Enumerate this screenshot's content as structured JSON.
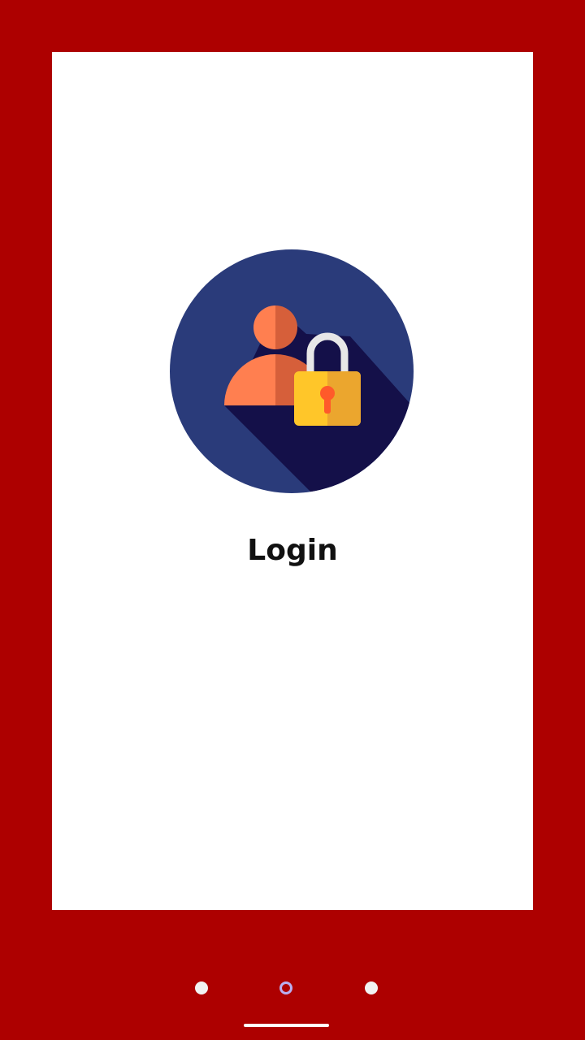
{
  "screen": {
    "title": "Login",
    "logo_icon": "user-lock-icon"
  },
  "pager": {
    "count": 3,
    "active_index": 1
  },
  "colors": {
    "background": "#ad0000",
    "card": "#ffffff",
    "logo_circle": "#2a3b7a",
    "logo_shadow": "#141049",
    "person": "#ff7f50",
    "person_shade": "#d65f3a",
    "lock_body": "#ffc629",
    "lock_body_shade": "#eba62e",
    "lock_shackle": "#e7e7e7",
    "keyhole": "#ff5a2a"
  }
}
